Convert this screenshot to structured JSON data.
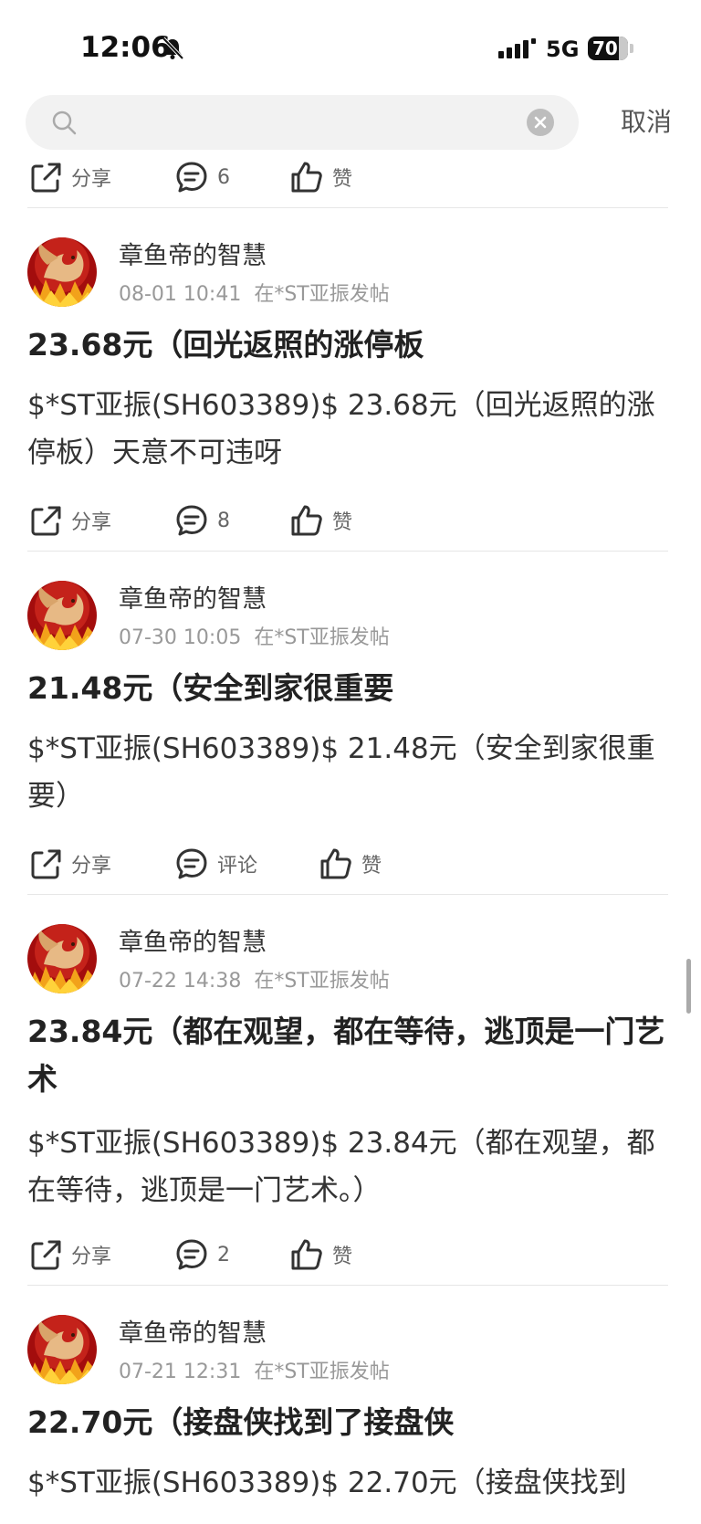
{
  "status_bar": {
    "time": "12:06",
    "network": "5G",
    "battery": "70"
  },
  "search": {
    "placeholder": "",
    "cancel_label": "取消"
  },
  "top_actions": {
    "share": "分享",
    "comments": "6",
    "like": "赞"
  },
  "posts": [
    {
      "author": "章鱼帝的智慧",
      "time": "08-01 10:41",
      "location": "在*ST亚振发帖",
      "title": "23.68元（回光返照的涨停板",
      "body": "$*ST亚振(SH603389)$ 23.68元（回光返照的涨停板）天意不可违呀",
      "share": "分享",
      "comments": "8",
      "like": "赞"
    },
    {
      "author": "章鱼帝的智慧",
      "time": "07-30 10:05",
      "location": "在*ST亚振发帖",
      "title": "21.48元（安全到家很重要",
      "body": "$*ST亚振(SH603389)$ 21.48元（安全到家很重要）",
      "share": "分享",
      "comments": "评论",
      "like": "赞"
    },
    {
      "author": "章鱼帝的智慧",
      "time": "07-22 14:38",
      "location": "在*ST亚振发帖",
      "title": "23.84元（都在观望，都在等待，逃顶是一门艺术",
      "body": "$*ST亚振(SH603389)$ 23.84元（都在观望，都在等待，逃顶是一门艺术。）",
      "share": "分享",
      "comments": "2",
      "like": "赞"
    },
    {
      "author": "章鱼帝的智慧",
      "time": "07-21 12:31",
      "location": "在*ST亚振发帖",
      "title": "22.70元（接盘侠找到了接盘侠",
      "body": "$*ST亚振(SH603389)$ 22.70元（接盘侠找到"
    }
  ]
}
